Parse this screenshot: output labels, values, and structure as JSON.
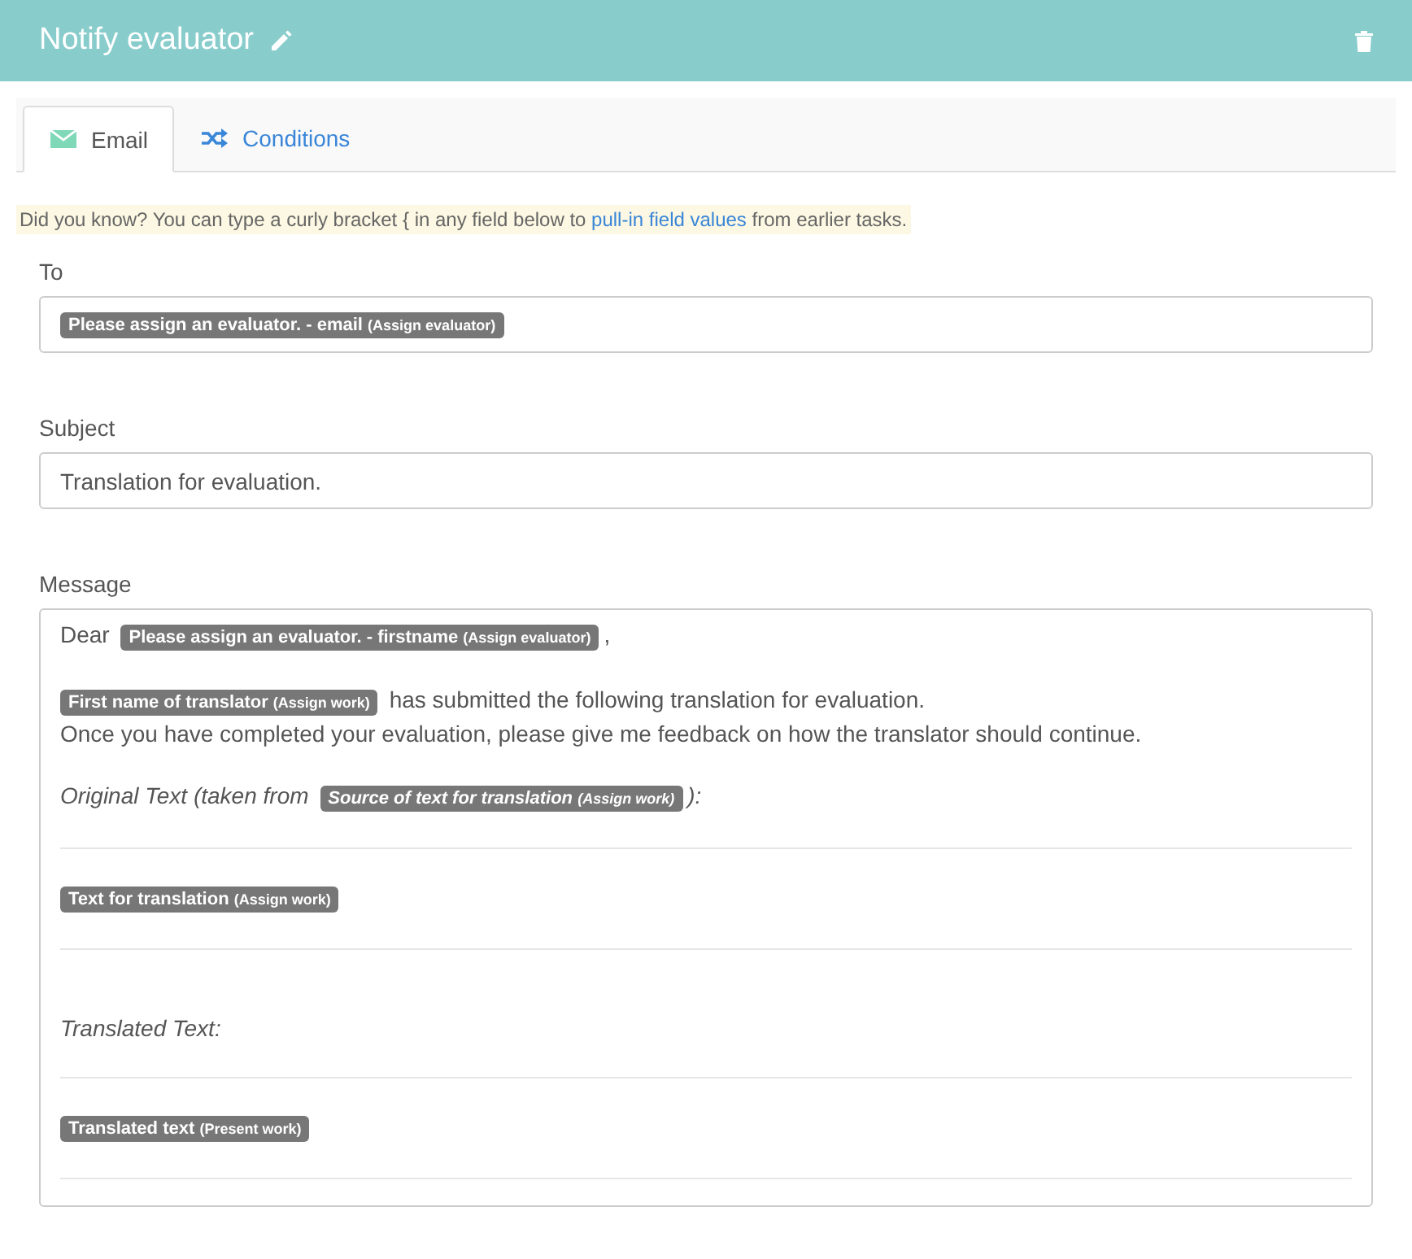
{
  "header": {
    "title": "Notify evaluator"
  },
  "tabs": [
    {
      "label": "Email",
      "selected": true
    },
    {
      "label": "Conditions",
      "selected": false
    }
  ],
  "hint": {
    "before": "Did you know? You can type a curly bracket { in any field below to ",
    "link": "pull-in field values",
    "after": " from earlier tasks."
  },
  "to": {
    "label": "To",
    "tags": [
      {
        "label": "Please assign an evaluator. - email",
        "source": "(Assign evaluator)"
      }
    ]
  },
  "subject": {
    "label": "Subject",
    "value": "Translation for evaluation."
  },
  "message": {
    "label": "Message",
    "blocks": [
      {
        "kind": "line",
        "italic": false,
        "parts": [
          {
            "kind": "text",
            "text": "Dear "
          },
          {
            "kind": "tag",
            "label": "Please assign an evaluator. - firstname",
            "source": "(Assign evaluator)"
          },
          {
            "kind": "text",
            "text": ","
          }
        ]
      },
      {
        "kind": "blank"
      },
      {
        "kind": "line",
        "italic": false,
        "parts": [
          {
            "kind": "tag",
            "label": "First name of translator",
            "source": "(Assign work)"
          },
          {
            "kind": "text",
            "text": " has submitted the following translation for evaluation."
          }
        ]
      },
      {
        "kind": "line",
        "italic": false,
        "parts": [
          {
            "kind": "text",
            "text": "Once you have completed your evaluation, please give me feedback on how the translator should continue."
          }
        ]
      },
      {
        "kind": "blank"
      },
      {
        "kind": "line",
        "italic": true,
        "parts": [
          {
            "kind": "text",
            "text": "Original Text (taken from "
          },
          {
            "kind": "tag",
            "label": "Source of text for translation",
            "source": "(Assign work)"
          },
          {
            "kind": "text",
            "text": "):"
          }
        ]
      },
      {
        "kind": "rule"
      },
      {
        "kind": "line",
        "italic": false,
        "parts": [
          {
            "kind": "tag",
            "label": "Text for translation",
            "source": "(Assign work)"
          }
        ]
      },
      {
        "kind": "rule"
      },
      {
        "kind": "blank"
      },
      {
        "kind": "line",
        "italic": true,
        "parts": [
          {
            "kind": "text",
            "text": "Translated Text:"
          }
        ]
      },
      {
        "kind": "rule"
      },
      {
        "kind": "line",
        "italic": false,
        "parts": [
          {
            "kind": "tag",
            "label": "Translated text",
            "source": "(Present work)"
          }
        ]
      },
      {
        "kind": "rule"
      }
    ]
  }
}
